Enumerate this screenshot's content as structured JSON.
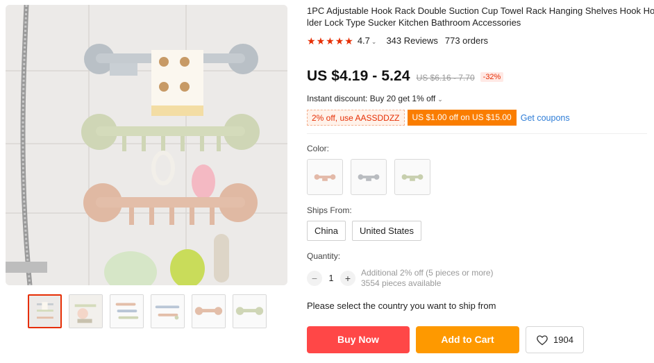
{
  "product": {
    "title_line1": "1PC Adjustable Hook Rack Double Suction Cup Towel Rack Hanging Shelves Hook Ho",
    "title_line2": "lder Lock Type Sucker Kitchen Bathroom Accessories",
    "rating": "4.7",
    "stars_filled": 5,
    "reviews": "343 Reviews",
    "orders": "773 orders"
  },
  "price": {
    "current": "US $4.19 - 5.24",
    "original": "US $6.16 - 7.70",
    "discount": "-32%"
  },
  "promo": {
    "instant_discount": "Instant discount: Buy 20 get 1% off",
    "coupon_code": "2% off, use AASSDDZZ",
    "store_coupon": "US $1.00 off on US $15.00",
    "get_coupons": "Get coupons"
  },
  "color": {
    "label": "Color:",
    "options": [
      {
        "name": "pink",
        "color": "#e3b9a8"
      },
      {
        "name": "gray",
        "color": "#b9bcc0"
      },
      {
        "name": "green",
        "color": "#c7cfae"
      }
    ]
  },
  "shipping": {
    "label": "Ships From:",
    "options": [
      "China",
      "United States"
    ],
    "note": "Please select the country you want to ship from"
  },
  "quantity": {
    "label": "Quantity:",
    "value": "1",
    "minus": "−",
    "plus": "+",
    "additional": "Additional 2% off (5 pieces or more)",
    "available": "3554 pieces available"
  },
  "actions": {
    "buy_now": "Buy Now",
    "add_to_cart": "Add to Cart",
    "wishlist_count": "1904"
  },
  "colors": {
    "accent_red": "#e62e04",
    "buy_now": "#ff4747",
    "add_to_cart": "#fe9900",
    "link_blue": "#2e7dd7",
    "coupon_orange": "#fa7d00"
  },
  "icons": {
    "star": "star-icon",
    "chevron": "chevron-down-icon",
    "heart": "heart-icon"
  }
}
